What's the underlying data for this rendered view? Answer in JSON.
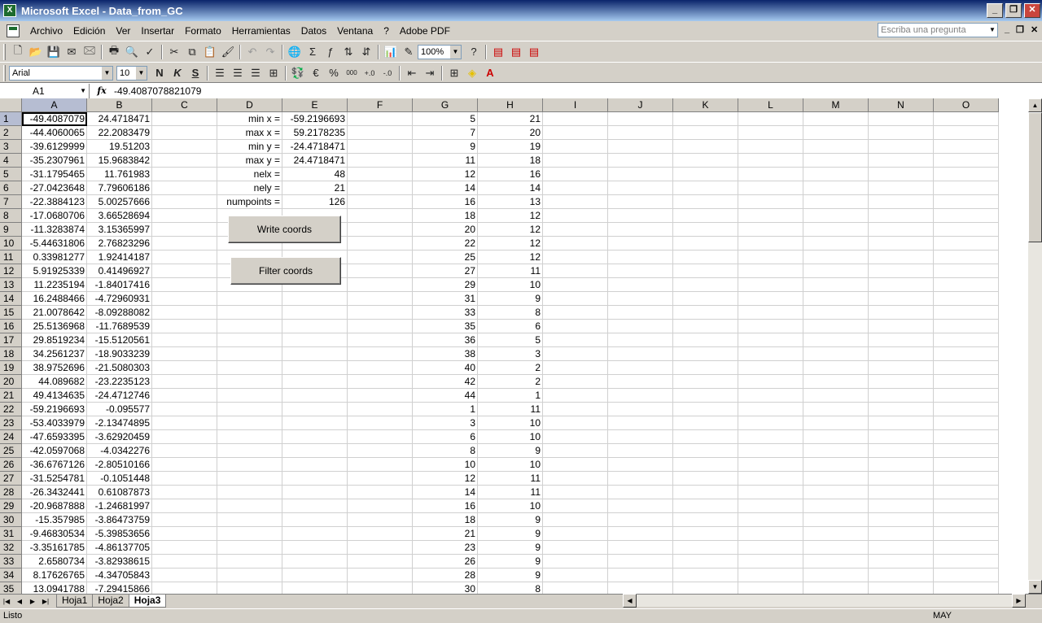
{
  "window": {
    "title": "Microsoft Excel - Data_from_GC",
    "app_icon": "X"
  },
  "menu": [
    "Archivo",
    "Edición",
    "Ver",
    "Insertar",
    "Formato",
    "Herramientas",
    "Datos",
    "Ventana",
    "?",
    "Adobe PDF"
  ],
  "ask_placeholder": "Escriba una pregunta",
  "toolbar": {
    "zoom": "100%",
    "font": "Arial",
    "size": "10",
    "bold": "N",
    "italic": "K",
    "underline": "S",
    "currency": "€",
    "percent": "%",
    "thousands": "000"
  },
  "formula": {
    "name_box": "A1",
    "fx": "fx",
    "value": "-49.4087078821079"
  },
  "columns": [
    "A",
    "B",
    "C",
    "D",
    "E",
    "F",
    "G",
    "H",
    "I",
    "J",
    "K",
    "L",
    "M",
    "N",
    "O"
  ],
  "rows": [
    {
      "n": "1",
      "A": "-49.4087079",
      "B": "24.4718471",
      "D": "min x =",
      "E": "-59.2196693",
      "G": "5",
      "H": "21"
    },
    {
      "n": "2",
      "A": "-44.4060065",
      "B": "22.2083479",
      "D": "max x =",
      "E": "59.2178235",
      "G": "7",
      "H": "20"
    },
    {
      "n": "3",
      "A": "-39.6129999",
      "B": "19.51203",
      "D": "min y =",
      "E": "-24.4718471",
      "G": "9",
      "H": "19"
    },
    {
      "n": "4",
      "A": "-35.2307961",
      "B": "15.9683842",
      "D": "max y =",
      "E": "24.4718471",
      "G": "11",
      "H": "18"
    },
    {
      "n": "5",
      "A": "-31.1795465",
      "B": "11.761983",
      "D": "nelx =",
      "E": "48",
      "G": "12",
      "H": "16"
    },
    {
      "n": "6",
      "A": "-27.0423648",
      "B": "7.79606186",
      "D": "nely =",
      "E": "21",
      "G": "14",
      "H": "14"
    },
    {
      "n": "7",
      "A": "-22.3884123",
      "B": "5.00257666",
      "D": "numpoints =",
      "E": "126",
      "G": "16",
      "H": "13"
    },
    {
      "n": "8",
      "A": "-17.0680706",
      "B": "3.66528694",
      "G": "18",
      "H": "12"
    },
    {
      "n": "9",
      "A": "-11.3283874",
      "B": "3.15365997",
      "G": "20",
      "H": "12"
    },
    {
      "n": "10",
      "A": "-5.44631806",
      "B": "2.76823296",
      "G": "22",
      "H": "12"
    },
    {
      "n": "11",
      "A": "0.33981277",
      "B": "1.92414187",
      "G": "25",
      "H": "12"
    },
    {
      "n": "12",
      "A": "5.91925339",
      "B": "0.41496927",
      "G": "27",
      "H": "11"
    },
    {
      "n": "13",
      "A": "11.2235194",
      "B": "-1.84017416",
      "G": "29",
      "H": "10"
    },
    {
      "n": "14",
      "A": "16.2488466",
      "B": "-4.72960931",
      "G": "31",
      "H": "9"
    },
    {
      "n": "15",
      "A": "21.0078642",
      "B": "-8.09288082",
      "G": "33",
      "H": "8"
    },
    {
      "n": "16",
      "A": "25.5136968",
      "B": "-11.7689539",
      "G": "35",
      "H": "6"
    },
    {
      "n": "17",
      "A": "29.8519234",
      "B": "-15.5120561",
      "G": "36",
      "H": "5"
    },
    {
      "n": "18",
      "A": "34.2561237",
      "B": "-18.9033239",
      "G": "38",
      "H": "3"
    },
    {
      "n": "19",
      "A": "38.9752696",
      "B": "-21.5080303",
      "G": "40",
      "H": "2"
    },
    {
      "n": "20",
      "A": "44.089682",
      "B": "-23.2235123",
      "G": "42",
      "H": "2"
    },
    {
      "n": "21",
      "A": "49.4134635",
      "B": "-24.4712746",
      "G": "44",
      "H": "1"
    },
    {
      "n": "22",
      "A": "-59.2196693",
      "B": "-0.095577",
      "G": "1",
      "H": "11"
    },
    {
      "n": "23",
      "A": "-53.4033979",
      "B": "-2.13474895",
      "G": "3",
      "H": "10"
    },
    {
      "n": "24",
      "A": "-47.6593395",
      "B": "-3.62920459",
      "G": "6",
      "H": "10"
    },
    {
      "n": "25",
      "A": "-42.0597068",
      "B": "-4.0342276",
      "G": "8",
      "H": "9"
    },
    {
      "n": "26",
      "A": "-36.6767126",
      "B": "-2.80510166",
      "G": "10",
      "H": "10"
    },
    {
      "n": "27",
      "A": "-31.5254781",
      "B": "-0.1051448",
      "G": "12",
      "H": "11"
    },
    {
      "n": "28",
      "A": "-26.3432441",
      "B": "0.61087873",
      "G": "14",
      "H": "11"
    },
    {
      "n": "29",
      "A": "-20.9687888",
      "B": "-1.24681997",
      "G": "16",
      "H": "10"
    },
    {
      "n": "30",
      "A": "-15.357985",
      "B": "-3.86473759",
      "G": "18",
      "H": "9"
    },
    {
      "n": "31",
      "A": "-9.46830534",
      "B": "-5.39853656",
      "G": "21",
      "H": "9"
    },
    {
      "n": "32",
      "A": "-3.35161785",
      "B": "-4.86137705",
      "G": "23",
      "H": "9"
    },
    {
      "n": "33",
      "A": "2.6580734",
      "B": "-3.82938615",
      "G": "26",
      "H": "9"
    },
    {
      "n": "34",
      "A": "8.17626765",
      "B": "-4.34705843",
      "G": "28",
      "H": "9"
    },
    {
      "n": "35",
      "A": "13.0941788",
      "B": "-7.29415866",
      "G": "30",
      "H": "8"
    }
  ],
  "buttons": {
    "write": "Write coords",
    "filter": "Filter coords"
  },
  "sheets": [
    "Hoja1",
    "Hoja2",
    "Hoja3"
  ],
  "active_sheet": "Hoja3",
  "status": {
    "left": "Listo",
    "caps": "MAY"
  }
}
